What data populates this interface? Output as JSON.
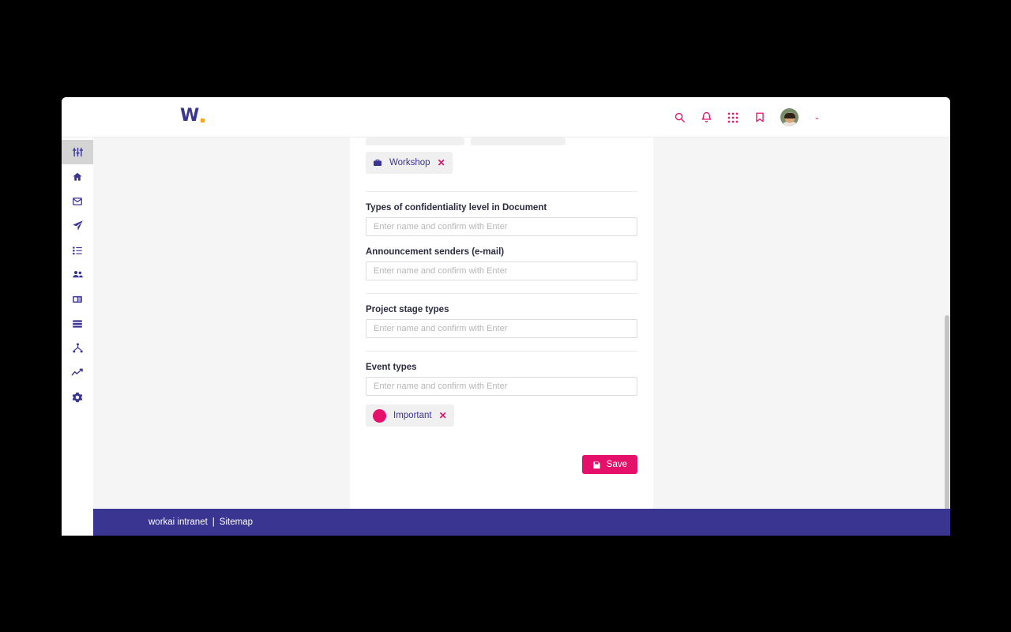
{
  "brand": {
    "logo_letter": "W",
    "logo_dot_color": "#f5a623",
    "logo_color": "#3b3592",
    "accent_color": "#e5106a",
    "footer_color": "#3b3592"
  },
  "header": {
    "icons": [
      {
        "name": "search-icon",
        "label": "Search"
      },
      {
        "name": "bell-icon",
        "label": "Notifications"
      },
      {
        "name": "grid-apps-icon",
        "label": "Apps"
      },
      {
        "name": "bookmark-icon",
        "label": "Bookmarks"
      }
    ],
    "avatar_name": "avatar",
    "chevron": "⌄"
  },
  "sidebar": {
    "items": [
      {
        "name": "sidebar-item-settings-sliders",
        "icon": "sliders-icon",
        "active": true
      },
      {
        "name": "sidebar-item-home",
        "icon": "home-icon",
        "active": false
      },
      {
        "name": "sidebar-item-mail",
        "icon": "envelope-icon",
        "active": false
      },
      {
        "name": "sidebar-item-send",
        "icon": "paper-plane-icon",
        "active": false
      },
      {
        "name": "sidebar-item-tasks",
        "icon": "list-check-icon",
        "active": false
      },
      {
        "name": "sidebar-item-people",
        "icon": "users-icon",
        "active": false
      },
      {
        "name": "sidebar-item-news",
        "icon": "news-card-icon",
        "active": false
      },
      {
        "name": "sidebar-item-directory",
        "icon": "list-rows-icon",
        "active": false
      },
      {
        "name": "sidebar-item-structure",
        "icon": "sitemap-icon",
        "active": false
      },
      {
        "name": "sidebar-item-analytics",
        "icon": "trend-line-icon",
        "active": false
      },
      {
        "name": "sidebar-item-configuration",
        "icon": "gear-icon",
        "active": false
      }
    ]
  },
  "form": {
    "top_tags_clipped": [
      {
        "label": "",
        "icon": "clipped-chip-icon"
      },
      {
        "label": "",
        "icon": "clipped-chip-icon"
      }
    ],
    "workshop_tag": {
      "label": "Workshop",
      "icon": "briefcase-icon",
      "remove": "✕"
    },
    "fields": [
      {
        "label": "Types of confidentiality level in Document",
        "placeholder": "Enter name and confirm with Enter",
        "value": "",
        "name": "confidentiality-level-input"
      },
      {
        "label": "Announcement senders (e-mail)",
        "placeholder": "Enter name and confirm with Enter",
        "value": "",
        "name": "announcement-senders-input"
      },
      {
        "label": "Project stage types",
        "placeholder": "Enter name and confirm with Enter",
        "value": "",
        "name": "project-stage-types-input"
      },
      {
        "label": "Event types",
        "placeholder": "Enter name and confirm with Enter",
        "value": "",
        "name": "event-types-input"
      }
    ],
    "event_tag": {
      "label": "Important",
      "dot_color": "#e5106a",
      "remove": "✕"
    },
    "save_label": "Save"
  },
  "footer": {
    "brand_text": "workai intranet",
    "separator": "|",
    "sitemap_label": "Sitemap"
  }
}
